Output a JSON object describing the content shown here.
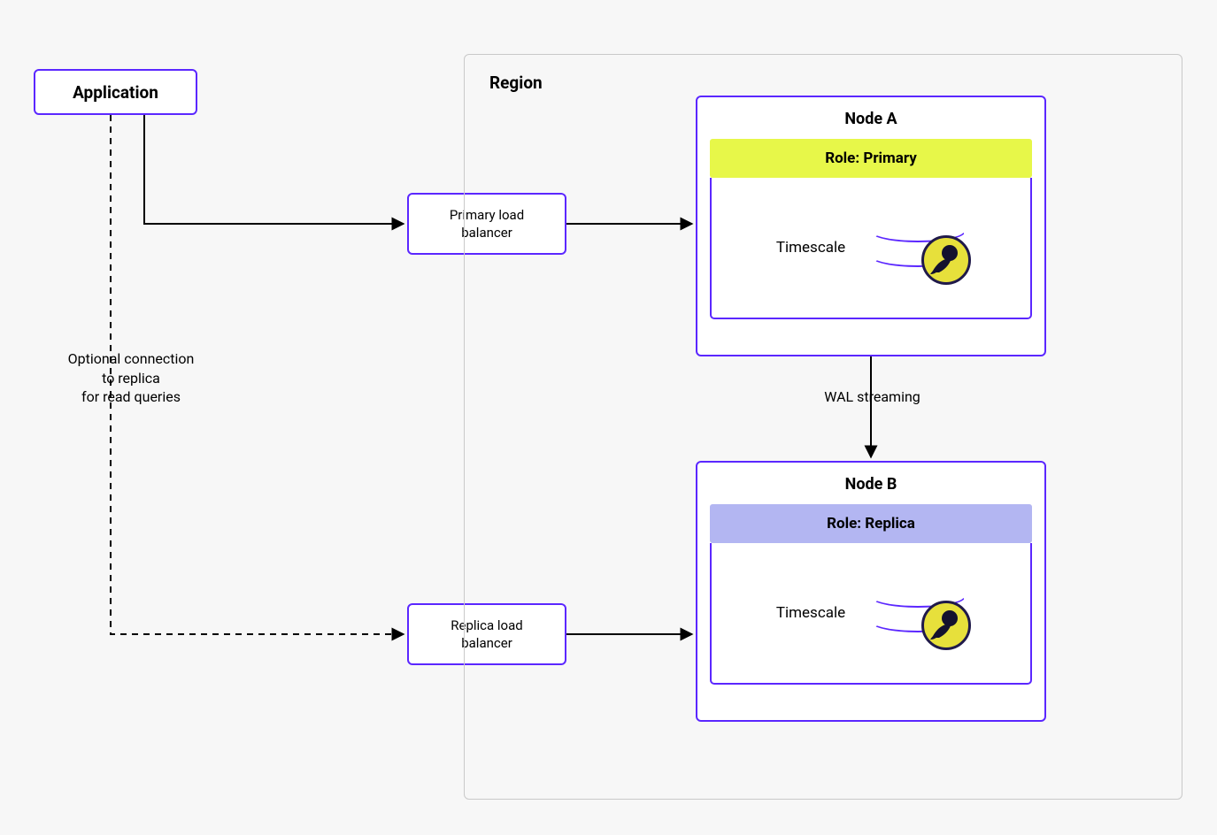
{
  "application": {
    "label": "Application"
  },
  "region": {
    "title": "Region"
  },
  "lb": {
    "primary": "Primary load\nbalancer",
    "replica": "Replica load\nbalancer"
  },
  "nodes": {
    "a": {
      "title": "Node A",
      "role": "Role: Primary",
      "db_label": "Timescale"
    },
    "b": {
      "title": "Node B",
      "role": "Role: Replica",
      "db_label": "Timescale"
    }
  },
  "captions": {
    "optional": "Optional connection\nto replica\nfor read queries",
    "wal": "WAL streaming"
  },
  "colors": {
    "accent": "#5b27ff",
    "primary_role_bg": "#e7f749",
    "replica_role_bg": "#b3b6f2",
    "canvas_bg": "#f7f7f7"
  },
  "chart_data": {
    "type": "diagram",
    "title": "Timescale high-availability / read-replica architecture",
    "nodes": [
      {
        "id": "app",
        "label": "Application"
      },
      {
        "id": "lb_primary",
        "label": "Primary load balancer"
      },
      {
        "id": "lb_replica",
        "label": "Replica load balancer"
      },
      {
        "id": "region",
        "label": "Region",
        "type": "group",
        "children": [
          "node_a",
          "node_b"
        ]
      },
      {
        "id": "node_a",
        "label": "Node A",
        "role": "Primary",
        "service": "Timescale"
      },
      {
        "id": "node_b",
        "label": "Node B",
        "role": "Replica",
        "service": "Timescale"
      }
    ],
    "edges": [
      {
        "from": "app",
        "to": "lb_primary",
        "style": "solid"
      },
      {
        "from": "app",
        "to": "lb_replica",
        "style": "dashed",
        "label": "Optional connection to replica for read queries"
      },
      {
        "from": "lb_primary",
        "to": "node_a",
        "style": "solid"
      },
      {
        "from": "lb_replica",
        "to": "node_b",
        "style": "solid"
      },
      {
        "from": "node_a",
        "to": "node_b",
        "style": "solid",
        "label": "WAL streaming"
      }
    ]
  }
}
